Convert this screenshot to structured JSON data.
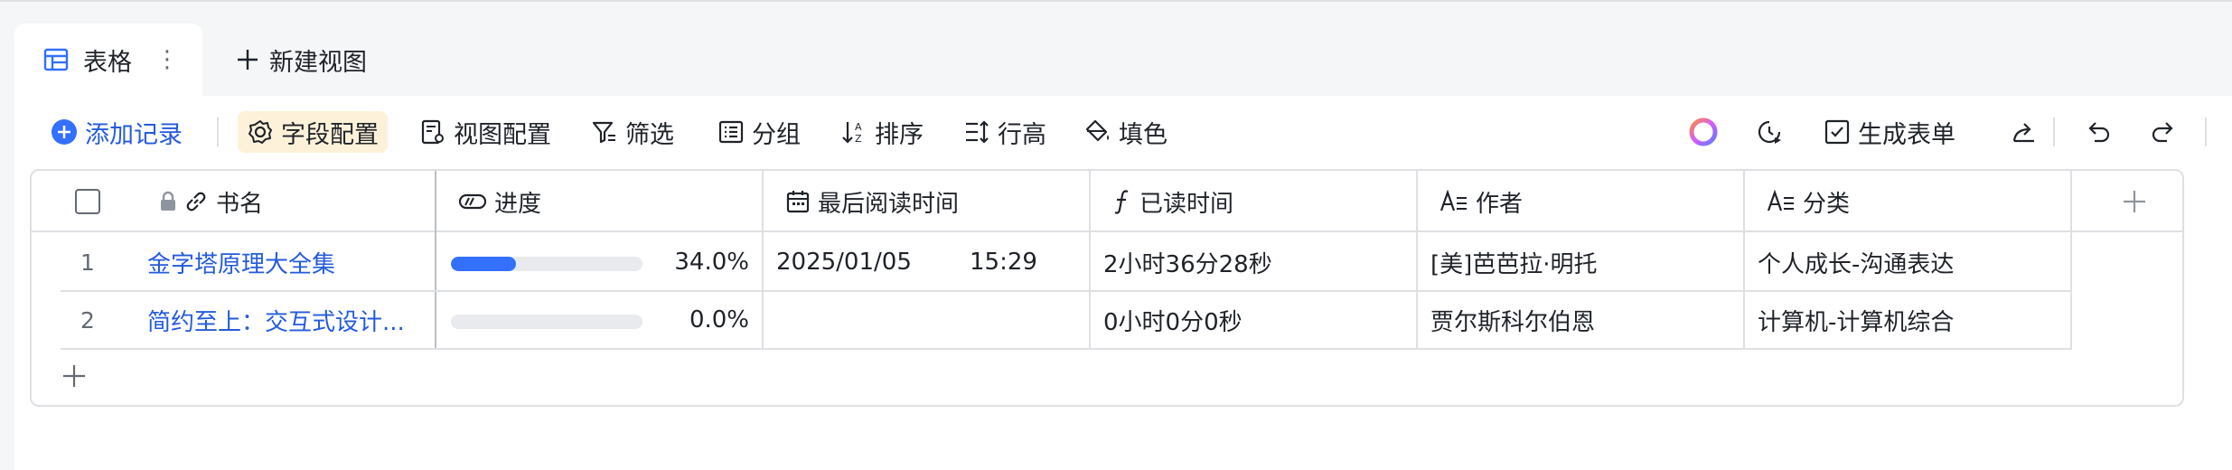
{
  "tabs": {
    "active_label": "表格",
    "more_glyph": "⋮",
    "new_view_label": "新建视图"
  },
  "toolbar": {
    "add_record": "添加记录",
    "field_config": "字段配置",
    "view_config": "视图配置",
    "filter": "筛选",
    "group": "分组",
    "sort": "排序",
    "row_height": "行高",
    "fill_color": "填色",
    "generate_form": "生成表单"
  },
  "table": {
    "columns": [
      {
        "label": "书名",
        "icon": "link-icon"
      },
      {
        "label": "进度",
        "icon": "progress-icon"
      },
      {
        "label": "最后阅读时间",
        "icon": "calendar-icon"
      },
      {
        "label": "已读时间",
        "icon": "formula-icon"
      },
      {
        "label": "作者",
        "icon": "text-icon"
      },
      {
        "label": "分类",
        "icon": "text-icon"
      }
    ],
    "rows": [
      {
        "num": "1",
        "title": "金字塔原理大全集",
        "progress": 0.34,
        "progress_text": "34.0%",
        "last_read_date": "2025/01/05",
        "last_read_time": "15:29",
        "read_duration": "2小时36分28秒",
        "author": "[美]芭芭拉·明托",
        "category": "个人成长-沟通表达"
      },
      {
        "num": "2",
        "title": "简约至上：交互式设计...",
        "progress": 0.0,
        "progress_text": "0.0%",
        "last_read_date": "",
        "last_read_time": "",
        "read_duration": "0小时0分0秒",
        "author": "贾尔斯科尔伯恩",
        "category": "计算机-计算机综合"
      }
    ]
  },
  "colors": {
    "accent": "#3370ff",
    "link": "#245bdb",
    "field_config_bg": "#fdf2d9"
  }
}
